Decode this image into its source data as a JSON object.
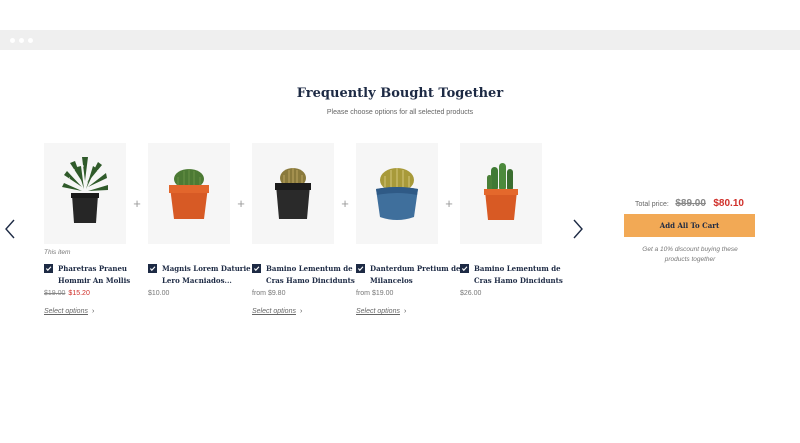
{
  "section": {
    "title": "Frequently Bought Together",
    "subtitle": "Please choose options for all selected products"
  },
  "products": [
    {
      "badge": "This item",
      "name": "Pharetras Praneu Hommir An Mollis",
      "price_old": "$19.00",
      "price_new": "$15.20",
      "price": "",
      "select_options": "Select options",
      "checked": true
    },
    {
      "badge": "",
      "name": "Magnis Lorem Daturie Lero Macniados...",
      "price": "$10.00",
      "select_options": "",
      "checked": true
    },
    {
      "badge": "",
      "name": "Bamino Lementum de Cras Hamo Dincidunts",
      "price": "from $9.80",
      "select_options": "Select options",
      "checked": true
    },
    {
      "badge": "",
      "name": "Danterdum Pretium de Milancelos",
      "price": "from $19.00",
      "select_options": "Select options",
      "checked": true
    },
    {
      "badge": "",
      "name": "Bamino Lementum de Cras Hamo Dincidunts",
      "price": "$26.00",
      "select_options": "",
      "checked": true
    }
  ],
  "plus_sign": "+",
  "summary": {
    "total_label": "Total price:",
    "total_old": "$89.00",
    "total_new": "$80.10",
    "add_all_button": "Add All To Cart",
    "discount_note": "Get a 10% discount buying these products together"
  },
  "icons": {
    "prev": "chevron-left-icon",
    "next": "chevron-right-icon",
    "select_chevron": "chevron-right-icon",
    "checkbox": "checkmark-icon"
  },
  "colors": {
    "accent": "#f2a955",
    "sale": "#d0302a",
    "navy": "#1d2a44"
  }
}
